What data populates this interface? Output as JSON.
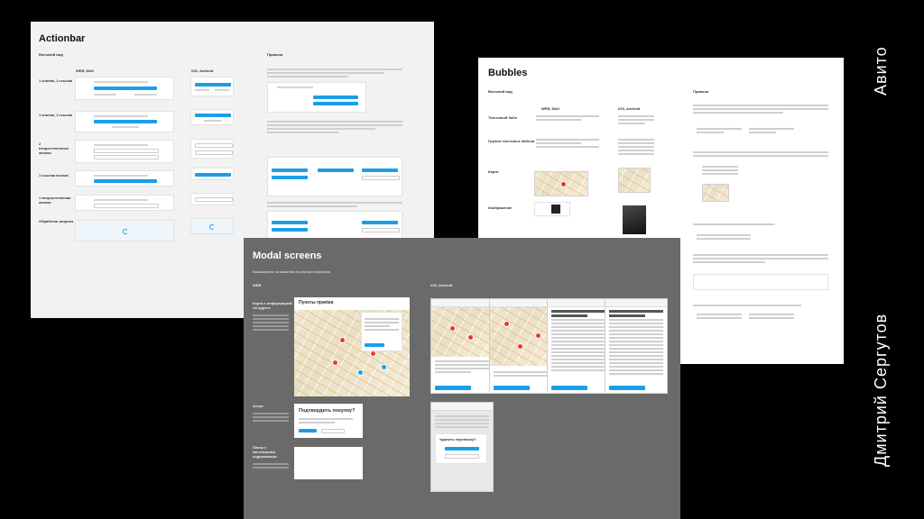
{
  "actionbar": {
    "title": "Actionbar",
    "section": "Внешний вид",
    "col_web": "WEB, MAV",
    "col_ios": "iOS, Android",
    "col_rules": "Правила",
    "rows": [
      "1 кнопка, 1 ссылка",
      "1 кнопка, 1 ссылка",
      "2 второстепенные кнопки",
      "1 ссылка кнопка",
      "1 второстепенная кнопка",
      "Обработка запроса"
    ]
  },
  "bubbles": {
    "title": "Bubbles",
    "section": "Внешний вид",
    "col_web": "WEB, MAV",
    "col_ios": "iOS, Android",
    "col_rules": "Правила",
    "rows": [
      "Текстовый бабл",
      "Группа текстовых баблов",
      "Карта",
      "Изображение"
    ]
  },
  "modal": {
    "title": "Modal screens",
    "subtitle": "Вызываются по нажатию на кнопки в actionbar",
    "col_web": "WEB",
    "col_ios": "iOS, Android",
    "rows": [
      "Карта с информацией об адресе",
      "Алерт",
      "Пикер с кастомными содержимым"
    ],
    "map_card_title": "Пункты приёма",
    "alert_title": "Подтвердить покупку?",
    "alert_phone_title": "Удалить переписку?"
  },
  "watermark": {
    "brand": "Авито",
    "author": "Дмитрий Сергутов"
  }
}
